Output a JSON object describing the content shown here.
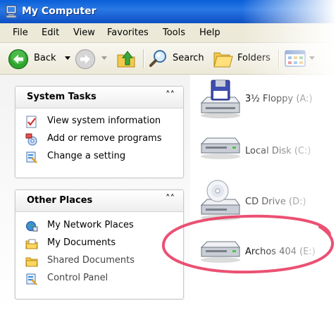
{
  "window": {
    "title": "My Computer"
  },
  "menu": [
    "File",
    "Edit",
    "View",
    "Favorites",
    "Tools",
    "Help"
  ],
  "toolbar": {
    "back": "Back",
    "search": "Search",
    "folders": "Folders"
  },
  "system_tasks": {
    "title": "System Tasks",
    "items": [
      "View system information",
      "Add or remove programs",
      "Change a setting"
    ]
  },
  "other_places": {
    "title": "Other Places",
    "items": [
      "My Network Places",
      "My Documents",
      "Shared Documents",
      "Control Panel"
    ]
  },
  "drives": [
    "3½ Floppy (A:)",
    "Local Disk (C:)",
    "CD Drive (D:)",
    "Archos 404 (E:)"
  ],
  "highlight_color": "#e8335a"
}
